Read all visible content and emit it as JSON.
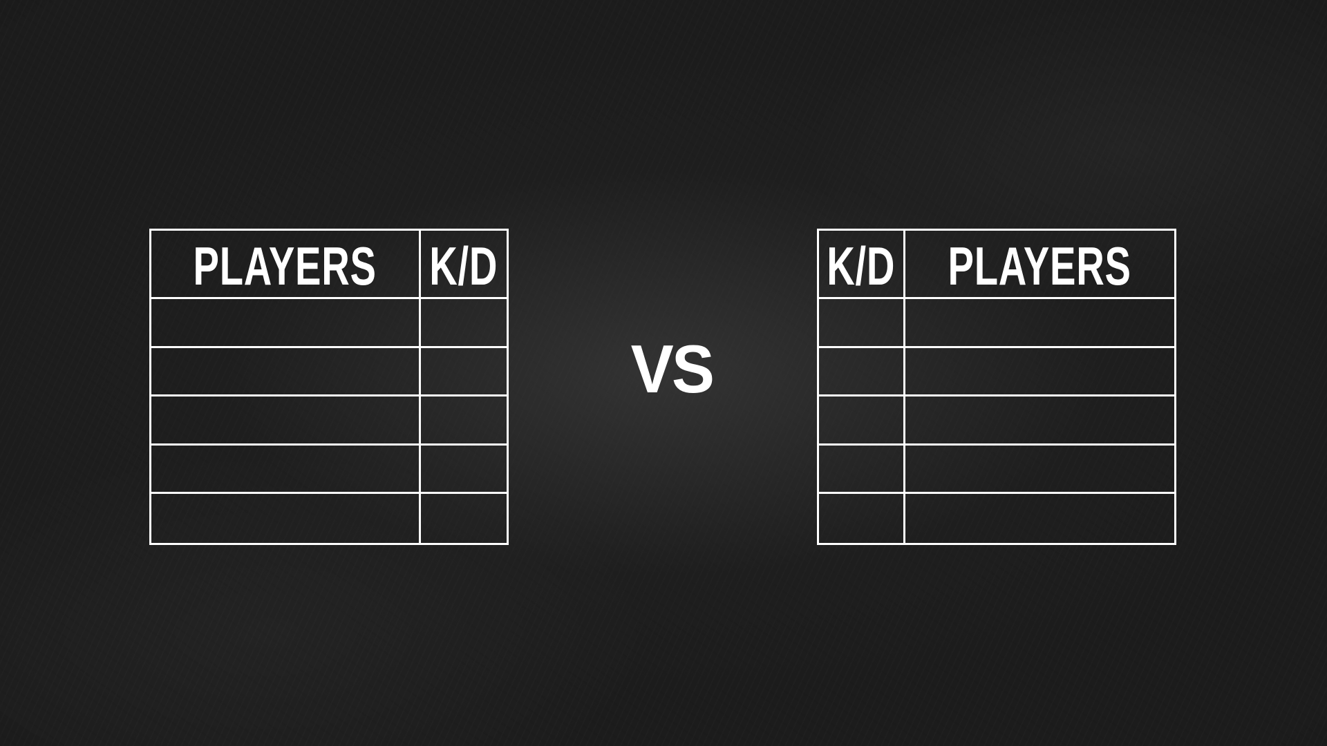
{
  "left_table": {
    "headers": [
      "PLAYERS",
      "K/D"
    ],
    "rows": [
      [
        "",
        ""
      ],
      [
        "",
        ""
      ],
      [
        "",
        ""
      ],
      [
        "",
        ""
      ],
      [
        "",
        ""
      ]
    ]
  },
  "right_table": {
    "headers": [
      "K/D",
      "PLAYERS"
    ],
    "rows": [
      [
        "",
        ""
      ],
      [
        "",
        ""
      ],
      [
        "",
        ""
      ],
      [
        "",
        ""
      ],
      [
        "",
        ""
      ]
    ]
  },
  "versus_label": "VS",
  "colors": {
    "background": "#1c1c1c",
    "lines": "#ffffff",
    "text": "#ffffff"
  }
}
